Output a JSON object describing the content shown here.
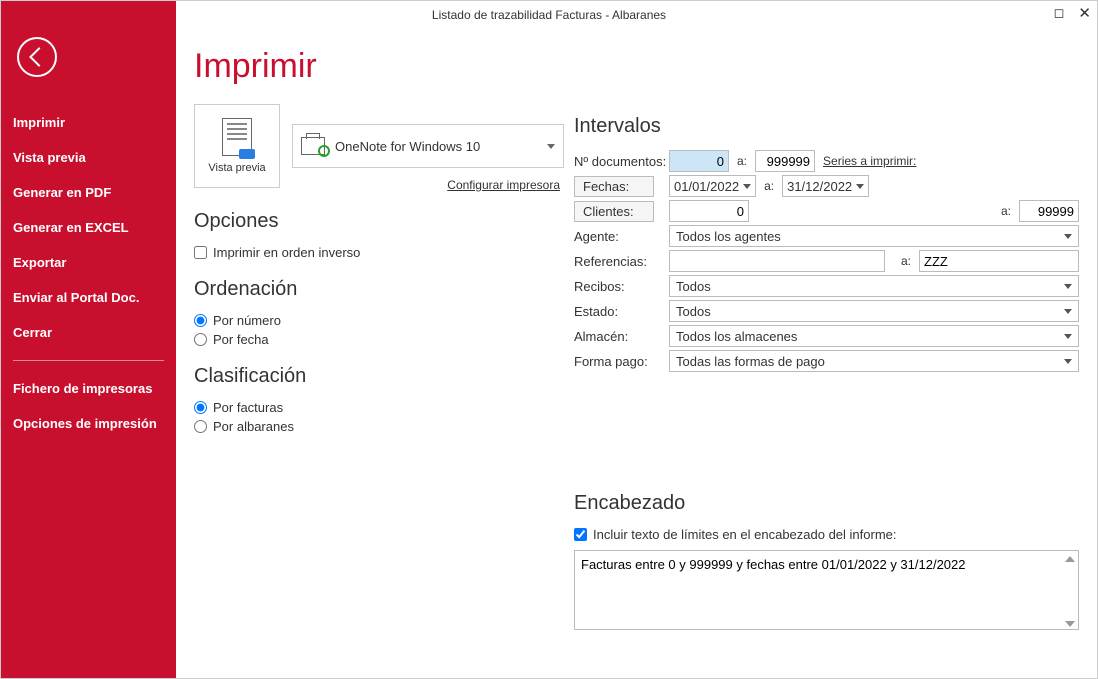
{
  "window": {
    "title": "Listado de trazabilidad Facturas - Albaranes"
  },
  "sidebar": {
    "items": [
      "Imprimir",
      "Vista previa",
      "Generar en PDF",
      "Generar en EXCEL",
      "Exportar",
      "Enviar al Portal Doc.",
      "Cerrar"
    ],
    "items2": [
      "Fichero de impresoras",
      "Opciones de impresión"
    ]
  },
  "page": {
    "title": "Imprimir",
    "preview_label": "Vista previa",
    "printer_name": "OneNote for Windows 10",
    "config_link": "Configurar impresora"
  },
  "opciones": {
    "title": "Opciones",
    "reverse": "Imprimir en orden inverso"
  },
  "ordenacion": {
    "title": "Ordenación",
    "por_numero": "Por número",
    "por_fecha": "Por fecha"
  },
  "clasificacion": {
    "title": "Clasificación",
    "por_facturas": "Por facturas",
    "por_albaranes": "Por albaranes"
  },
  "intervalos": {
    "title": "Intervalos",
    "ndoc_label": "Nº documentos:",
    "ndoc_from": "0",
    "ndoc_to": "999999",
    "to": "a:",
    "series_link": "Series a imprimir:",
    "fechas_btn": "Fechas:",
    "fecha_from": "01/01/2022",
    "fecha_to": "31/12/2022",
    "clientes_btn": "Clientes:",
    "cli_from": "0",
    "cli_to": "99999",
    "agente_label": "Agente:",
    "agente_val": "Todos los agentes",
    "ref_label": "Referencias:",
    "ref_from": "",
    "ref_to": "ZZZ",
    "recibos_label": "Recibos:",
    "recibos_val": "Todos",
    "estado_label": "Estado:",
    "estado_val": "Todos",
    "almacen_label": "Almacén:",
    "almacen_val": "Todos los almacenes",
    "forma_label": "Forma pago:",
    "forma_val": "Todas las formas de pago"
  },
  "encabezado": {
    "title": "Encabezado",
    "check": "Incluir texto de límites en el encabezado del informe:",
    "text": "Facturas entre 0 y 999999 y fechas entre 01/01/2022 y 31/12/2022"
  }
}
